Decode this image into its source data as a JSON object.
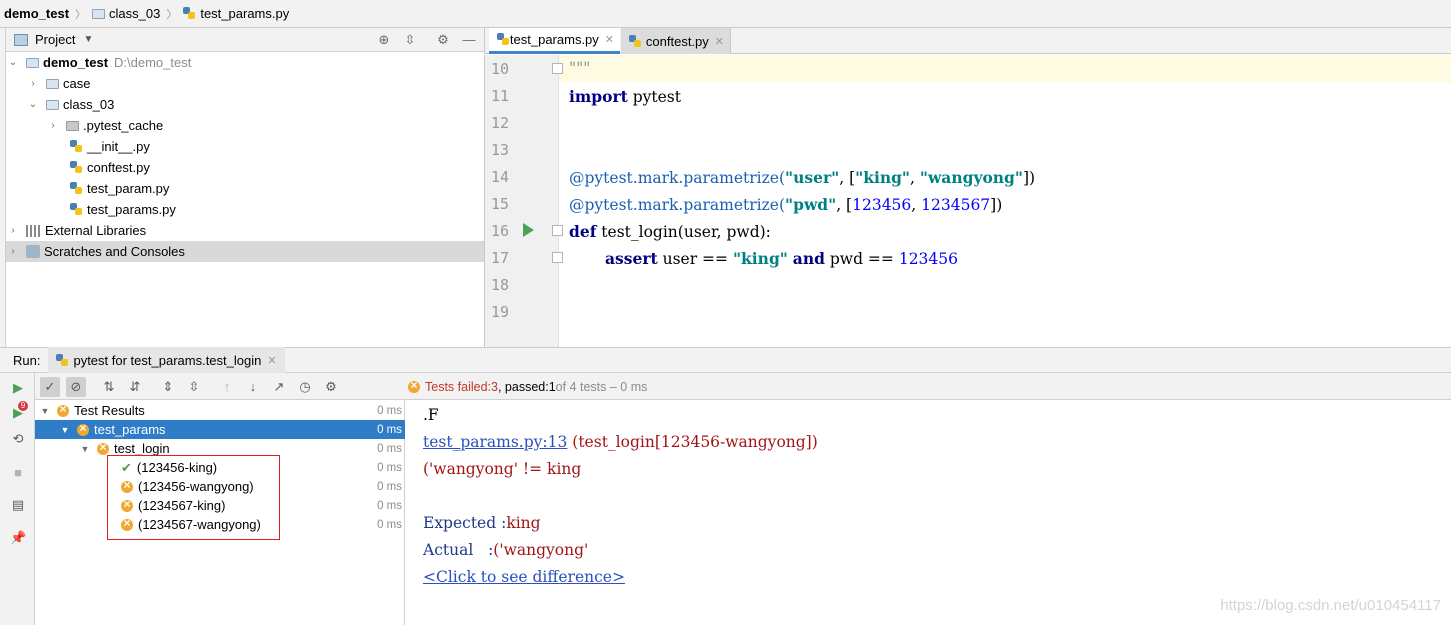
{
  "breadcrumb": {
    "project": "demo_test",
    "folder": "class_03",
    "file": "test_params.py"
  },
  "project_panel": {
    "title": "Project",
    "tree": [
      {
        "label": "demo_test",
        "path": "D:\\demo_test"
      },
      {
        "label": "case"
      },
      {
        "label": "class_03"
      },
      {
        "label": ".pytest_cache"
      },
      {
        "label": "__init__.py"
      },
      {
        "label": "conftest.py"
      },
      {
        "label": "test_param.py"
      },
      {
        "label": "test_params.py"
      },
      {
        "label": "External Libraries"
      },
      {
        "label": "Scratches and Consoles"
      }
    ]
  },
  "editor": {
    "tabs": [
      {
        "label": "test_params.py"
      },
      {
        "label": "conftest.py"
      }
    ],
    "line_numbers": [
      "10",
      "11",
      "12",
      "13",
      "14",
      "15",
      "16",
      "17",
      "18",
      "19"
    ],
    "code": {
      "l10": "\"\"\"",
      "l11_kw": "import",
      "l11_rest": " pytest",
      "l14_dec": "@pytest.mark.parametrize(",
      "l14_s1": "\"user\"",
      "l14_mid": ", [",
      "l14_s2": "\"king\"",
      "l14_comma": ", ",
      "l14_s3": "\"wangyong\"",
      "l14_end": "])",
      "l15_dec": "@pytest.mark.parametrize(",
      "l15_s1": "\"pwd\"",
      "l15_mid": ", [",
      "l15_n1": "123456",
      "l15_comma": ", ",
      "l15_n2": "1234567",
      "l15_end": "])",
      "l16_kw": "def",
      "l16_rest": " test_login(user, pwd):",
      "l17_kw": "assert",
      "l17_a": " user == ",
      "l17_s": "\"king\"",
      "l17_and": "and",
      "l17_b": " pwd == ",
      "l17_n": "123456"
    }
  },
  "run": {
    "label": "Run:",
    "tab_label": "pytest for test_params.test_login",
    "status": {
      "failed_label": "Tests failed: ",
      "failed": "3",
      "passed_label": ", passed: ",
      "passed": "1",
      "rest": " of 4 tests – 0 ms"
    },
    "results": [
      {
        "label": "Test Results",
        "duration": "0 ms"
      },
      {
        "label": "test_params",
        "duration": "0 ms"
      },
      {
        "label": "test_login",
        "duration": "0 ms"
      },
      {
        "label": "(123456-king)",
        "duration": "0 ms"
      },
      {
        "label": "(123456-wangyong)",
        "duration": "0 ms"
      },
      {
        "label": "(1234567-king)",
        "duration": "0 ms"
      },
      {
        "label": "(1234567-wangyong)",
        "duration": "0 ms"
      }
    ],
    "console": {
      "line1": ".F",
      "link1": "test_params.py:13",
      "line2_rest": " (test_login[123456-wangyong])",
      "line3": "('wangyong' != king",
      "expected_label": "Expected :",
      "expected_value": "king",
      "actual_label": "Actual   :",
      "actual_value": "('wangyong'",
      "diff_link": "<Click to see difference>"
    }
  },
  "watermark": "https://blog.csdn.net/u010454117",
  "colors": {
    "accent": "#2f7dc7",
    "fail": "#f0a830",
    "pass": "#4aa157",
    "run_green": "#4aa157"
  }
}
